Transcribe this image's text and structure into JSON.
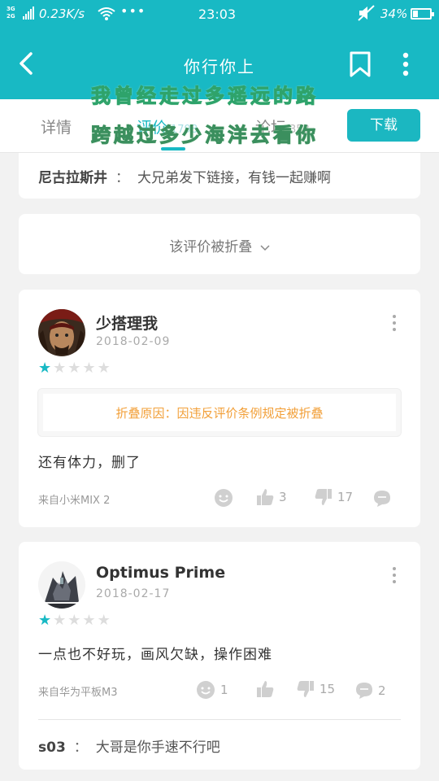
{
  "status_bar": {
    "network": "3G\n2G",
    "speed": "0.23K/s",
    "time": "23:03",
    "battery": "34%"
  },
  "app_bar": {
    "title": "你行你上"
  },
  "tabs": [
    {
      "label": "详情",
      "count": ""
    },
    {
      "label": "评价",
      "count": "1798"
    },
    {
      "label": "论坛",
      "count": "353"
    }
  ],
  "download_label": "下载",
  "overlay_lines": [
    "我曾经走过多遥远的路",
    "跨越过多少海洋去看你"
  ],
  "top_reply": {
    "user": "尼古拉斯井",
    "separator": "：",
    "text": "大兄弟发下链接，有钱一起赚啊"
  },
  "folded_notice": "该评价被折叠",
  "reviews": [
    {
      "user": "少搭理我",
      "date": "2018-02-09",
      "rating": 1,
      "fold_reason": "折叠原因：因违反评价条例规定被折叠",
      "text": "还有体力，删了",
      "source": "来自小米MIX 2",
      "likes": "3",
      "dislikes": "17",
      "comments": ""
    },
    {
      "user": "Optimus Prime",
      "date": "2018-02-17",
      "rating": 1,
      "text": "一点也不好玩，画风欠缺，操作困难",
      "source": "来自华为平板M3",
      "emoji_count": "1",
      "likes": "",
      "dislikes": "15",
      "comments": "2",
      "reply": {
        "user": "s03",
        "separator": "：",
        "text": "大哥是你手速不行吧"
      }
    }
  ],
  "colors": {
    "accent": "#18b9c4",
    "fold_reason": "#f2a03a"
  }
}
